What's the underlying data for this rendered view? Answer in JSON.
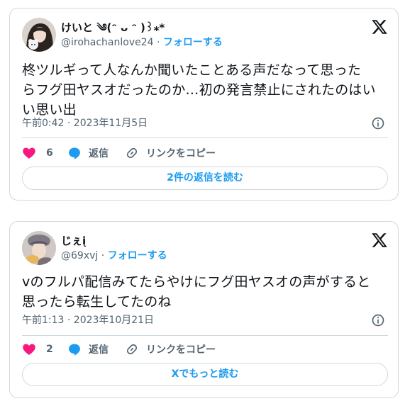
{
  "colors": {
    "accent": "#1d9bf0",
    "like": "#f91880",
    "text": "#0f1419",
    "secondary": "#536471",
    "border": "#cfd9de"
  },
  "tweets": [
    {
      "display_name": "けいと ༄(ᵔ ᴗ ᵔ )꒱⁎*",
      "handle": "@irohachanlove24",
      "separator": "·",
      "follow_label": "フォローする",
      "text_lines": [
        "柊ツルギって人なんか聞いたことある声だなって思った",
        "らフグ田ヤスオだったのか…初の発言禁止にされたのはい",
        "い思い出"
      ],
      "timestamp": "午前0:42 · 2023年11月5日",
      "like_count": "6",
      "reply_label": "返信",
      "copy_label": "リンクをコピー",
      "bottom_button": "2件の返信を読む",
      "icons": {
        "like": "heart-icon",
        "reply": "reply-bubble-icon",
        "copy": "link-icon",
        "info": "info-icon",
        "brand": "x-logo-icon"
      }
    },
    {
      "display_name": "じぇį",
      "handle": "@69xvj",
      "separator": "·",
      "follow_label": "フォローする",
      "text_lines": [
        "vのフルパ配信みてたらやけにフグ田ヤスオの声がすると",
        "思ったら転生してたのね"
      ],
      "timestamp": "午前1:13 · 2023年10月21日",
      "like_count": "2",
      "reply_label": "返信",
      "copy_label": "リンクをコピー",
      "bottom_button": "Xでもっと読む",
      "icons": {
        "like": "heart-icon",
        "reply": "reply-bubble-icon",
        "copy": "link-icon",
        "info": "info-icon",
        "brand": "x-logo-icon"
      }
    }
  ]
}
